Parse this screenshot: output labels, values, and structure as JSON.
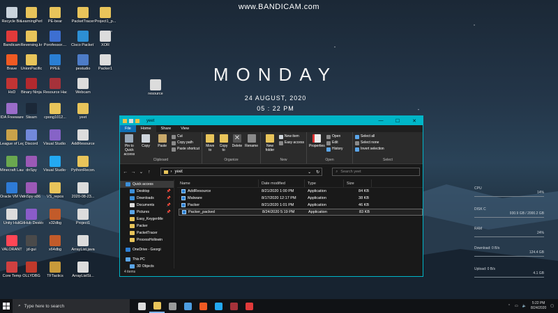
{
  "watermark": "www.BANDICAM.com",
  "desktop_clock": {
    "day": "MONDAY",
    "date": "24 AUGUST, 2020",
    "time": "05 : 22 PM"
  },
  "desktop_icons": [
    {
      "label": "Recycle Bin",
      "color": "#c9d3dc"
    },
    {
      "label": "LearningPerl",
      "color": "#e8c45a"
    },
    {
      "label": "PE-bear",
      "color": "#e8c45a"
    },
    {
      "label": "PacketTracer",
      "color": "#e8c45a"
    },
    {
      "label": "Project1_p...",
      "color": "#e8c45a"
    },
    {
      "label": "Bandicam",
      "color": "#e03a3a"
    },
    {
      "label": "Reversing.kr",
      "color": "#e8c45a"
    },
    {
      "label": "Porofessor....",
      "color": "#3d6fd1"
    },
    {
      "label": "Cisco Packet Tracer",
      "color": "#2d8fd4"
    },
    {
      "label": "XOR",
      "color": "#dcdcdc"
    },
    {
      "label": "Brave",
      "color": "#f05a23"
    },
    {
      "label": "UnionPacific",
      "color": "#e8c45a"
    },
    {
      "label": "PPEE",
      "color": "#2a7fd4"
    },
    {
      "label": "pestudio",
      "color": "#4d7cc7"
    },
    {
      "label": "Packer1",
      "color": "#dcdcdc"
    },
    {
      "label": "HxD",
      "color": "#c23434"
    },
    {
      "label": "Binary Ninja",
      "color": "#b3292e"
    },
    {
      "label": "Resource Hacker",
      "color": "#a6323a"
    },
    {
      "label": "Webcam",
      "color": "#dcdcdc"
    },
    {
      "label": "IDA Freeware",
      "color": "#9a6cc9"
    },
    {
      "label": "Steam",
      "color": "#1b2838"
    },
    {
      "label": "cpong1012...",
      "color": "#e8c45a"
    },
    {
      "label": "yeet",
      "color": "#e8c45a"
    },
    {
      "label": "League of Legends",
      "color": "#c9a24a"
    },
    {
      "label": "Discord",
      "color": "#7289da"
    },
    {
      "label": "Visual Studio 2019",
      "color": "#8663c7"
    },
    {
      "label": "AddResource",
      "color": "#dcdcdc"
    },
    {
      "label": "Minecraft Launcher",
      "color": "#6aa84f"
    },
    {
      "label": "dnSpy",
      "color": "#9b59b6"
    },
    {
      "label": "Visual Studio Code",
      "color": "#23a9f2"
    },
    {
      "label": "PythonRecon...",
      "color": "#e8c45a"
    },
    {
      "label": "Oracle VM VirtualBox",
      "color": "#2e7bd6"
    },
    {
      "label": "dnSpy-x86",
      "color": "#9b59b6"
    },
    {
      "label": "VS_repos",
      "color": "#e8c45a"
    },
    {
      "label": "2020-08-23...",
      "color": "#dcdcdc"
    },
    {
      "label": "Unity Hub",
      "color": "#dcdcdc"
    },
    {
      "label": "GitHub Desktop",
      "color": "#8a5cc9"
    },
    {
      "label": "x32dbg",
      "color": "#c25b2a"
    },
    {
      "label": "Project1",
      "color": "#dcdcdc"
    },
    {
      "label": "VALORANT",
      "color": "#ff4655"
    },
    {
      "label": "jd-gui",
      "color": "#4a4a4a"
    },
    {
      "label": "x64dbg",
      "color": "#c25b2a"
    },
    {
      "label": "ArrayList.java",
      "color": "#dcdcdc"
    },
    {
      "label": "Core Temp",
      "color": "#d04040"
    },
    {
      "label": "OLLYDBG",
      "color": "#c0392b"
    },
    {
      "label": "TFTactics",
      "color": "#c79a3a"
    },
    {
      "label": "ArrayListSt...",
      "color": "#dcdcdc"
    },
    {
      "label": "resource",
      "color": "#dcdcdc"
    }
  ],
  "stats": [
    {
      "label": "CPU",
      "value": "14%"
    },
    {
      "label": "DISK C",
      "value": "930.9 GB / 2000.2 GB"
    },
    {
      "label": "RAM",
      "value": "24%"
    },
    {
      "label": "Download: 0 B/s",
      "value": "124.4 GB"
    },
    {
      "label": "Upload: 0 B/s",
      "value": "4.1 GB"
    }
  ],
  "explorer": {
    "title": "yeet",
    "window_controls": [
      "—",
      "☐",
      "✕"
    ],
    "tabs": [
      "File",
      "Home",
      "Share",
      "View"
    ],
    "ribbon": {
      "clipboard": {
        "name": "Clipboard",
        "pin": "Pin to Quick access",
        "copy": "Copy",
        "paste": "Paste",
        "cut": "Cut",
        "copy_path": "Copy path",
        "paste_shortcut": "Paste shortcut"
      },
      "organize": {
        "name": "Organize",
        "move_to": "Move to",
        "copy_to": "Copy to",
        "delete": "Delete",
        "rename": "Rename"
      },
      "new": {
        "name": "New",
        "new_folder": "New folder",
        "new_item": "New item",
        "easy_access": "Easy access"
      },
      "open": {
        "name": "Open",
        "properties": "Properties",
        "open": "Open",
        "edit": "Edit",
        "history": "History"
      },
      "select": {
        "name": "Select",
        "select_all": "Select all",
        "select_none": "Select none",
        "invert": "Invert selection"
      }
    },
    "address": {
      "path": "yeet",
      "search_placeholder": "Search yeet"
    },
    "nav": [
      {
        "label": "Quick access",
        "indent": false,
        "pin": false,
        "selected": true,
        "color": "#3d8fd8"
      },
      {
        "label": "Desktop",
        "indent": true,
        "pin": true,
        "selected": false,
        "color": "#3d8fd8"
      },
      {
        "label": "Downloads",
        "indent": true,
        "pin": true,
        "selected": false,
        "color": "#3d8fd8"
      },
      {
        "label": "Documents",
        "indent": true,
        "pin": true,
        "selected": false,
        "color": "#dcdcdc"
      },
      {
        "label": "Pictures",
        "indent": true,
        "pin": true,
        "selected": false,
        "color": "#5aa5e8"
      },
      {
        "label": "Easy_KeygenMe",
        "indent": true,
        "pin": false,
        "selected": false,
        "color": "#e8c45a"
      },
      {
        "label": "Packer",
        "indent": true,
        "pin": false,
        "selected": false,
        "color": "#e8c45a"
      },
      {
        "label": "PacketTracer",
        "indent": true,
        "pin": false,
        "selected": false,
        "color": "#e8c45a"
      },
      {
        "label": "ProcessHollowin",
        "indent": true,
        "pin": false,
        "selected": false,
        "color": "#e8c45a"
      },
      {
        "label": "",
        "gap": true
      },
      {
        "label": "OneDrive - Georgi",
        "indent": false,
        "pin": false,
        "selected": false,
        "color": "#2d7fd4"
      },
      {
        "label": "",
        "gap": true
      },
      {
        "label": "This PC",
        "indent": false,
        "pin": false,
        "selected": false,
        "color": "#5aa5e8"
      },
      {
        "label": "3D Objects",
        "indent": true,
        "pin": false,
        "selected": false,
        "color": "#5aa5e8"
      }
    ],
    "columns": {
      "name": "Name",
      "date": "Date modified",
      "type": "Type",
      "size": "Size"
    },
    "files": [
      {
        "name": "AddResource",
        "date": "8/21/2020 1:00 PM",
        "type": "Application",
        "size": "84 KB",
        "selected": false
      },
      {
        "name": "Malware",
        "date": "8/17/2020 12:17 PM",
        "type": "Application",
        "size": "38 KB",
        "selected": false
      },
      {
        "name": "Packer",
        "date": "8/21/2020 1:01 PM",
        "type": "Application",
        "size": "46 KB",
        "selected": false
      },
      {
        "name": "Packer_packed",
        "date": "8/24/2020 5:19 PM",
        "type": "Application",
        "size": "83 KB",
        "selected": true
      }
    ],
    "status": "4 items"
  },
  "taskbar": {
    "search_placeholder": "Type here to search",
    "apps": [
      {
        "name": "taskview-icon",
        "color": "#dcdcdc"
      },
      {
        "name": "explorer-icon",
        "color": "#e8c45a"
      },
      {
        "name": "terminal-icon",
        "color": "#9a9a9a"
      },
      {
        "name": "dnspy-icon",
        "color": "#4d9de0"
      },
      {
        "name": "brave-icon",
        "color": "#f05a23"
      },
      {
        "name": "vscode-icon",
        "color": "#23a9f2"
      },
      {
        "name": "resource-hacker-icon",
        "color": "#a6323a"
      },
      {
        "name": "bandicam-icon",
        "color": "#e03a3a"
      }
    ],
    "time": "5:22 PM",
    "date": "8/24/2020"
  }
}
